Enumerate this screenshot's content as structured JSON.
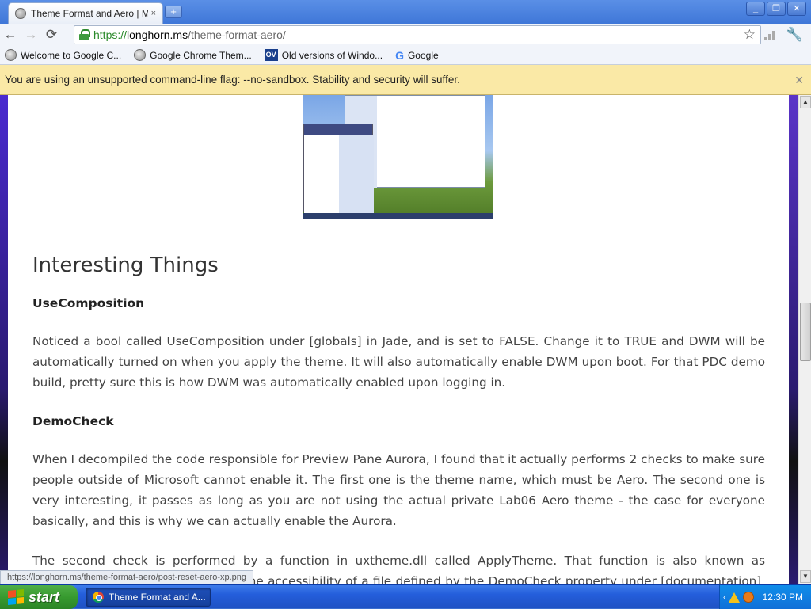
{
  "window": {
    "tab_title": "Theme Format and Aero | Micro",
    "tab_close": "×",
    "new_tab": "+",
    "controls": [
      "_",
      "❐",
      "✕"
    ]
  },
  "toolbar": {
    "back": "←",
    "forward": "→",
    "reload": "⟳",
    "url_scheme": "https://",
    "url_host": "longhorn.ms",
    "url_path": "/theme-format-aero/",
    "star": "☆",
    "wrench": "🔧"
  },
  "bookmarks": [
    {
      "label": "Welcome to Google C...",
      "icon": "globe-icon"
    },
    {
      "label": "Google Chrome Them...",
      "icon": "globe-icon"
    },
    {
      "label": "Old versions of Windo...",
      "icon": "ov-icon",
      "badge": "OV"
    },
    {
      "label": "Google",
      "icon": "google-icon",
      "badge": "G"
    }
  ],
  "infobar": {
    "message": "You are using an unsupported command-line flag: --no-sandbox. Stability and security will suffer.",
    "close": "✕"
  },
  "article": {
    "heading": "Interesting Things",
    "section1_title": "UseComposition",
    "section1_text": "Noticed a bool called UseComposition under [globals] in Jade, and is set to FALSE. Change it to TRUE and DWM will be automatically turned on when you apply the theme. It will also automatically enable DWM upon boot. For that PDC demo build, pretty sure this is how DWM was automatically enabled upon logging in.",
    "section2_title": "DemoCheck",
    "section2_text": "When I decompiled the code responsible for Preview Pane Aurora, I found that it actually performs 2 checks to make sure people outside of Microsoft cannot enable it. The first one is the theme name, which must be Aero. The second one is very interesting, it passes as long as you are not using the actual private Lab06 Aero theme - the case for everyone basically, and this is why we can actually enable the Aurora.",
    "section3_text": "The second check is performed by a function in uxtheme.dll called ApplyTheme. That function is also known as ThemepDemoCheck and it checks the accessibility of a file defined by the DemoCheck property under [documentation]. That file is"
  },
  "status_url": "https://longhorn.ms/theme-format-aero/post-reset-aero-xp.png",
  "scrollbar": {
    "up": "▲",
    "down": "▼",
    "position": 0.45
  },
  "taskbar": {
    "start_label": "start",
    "task_label": "Theme Format and A...",
    "tray_chevron": "‹",
    "clock": "12:30 PM"
  }
}
